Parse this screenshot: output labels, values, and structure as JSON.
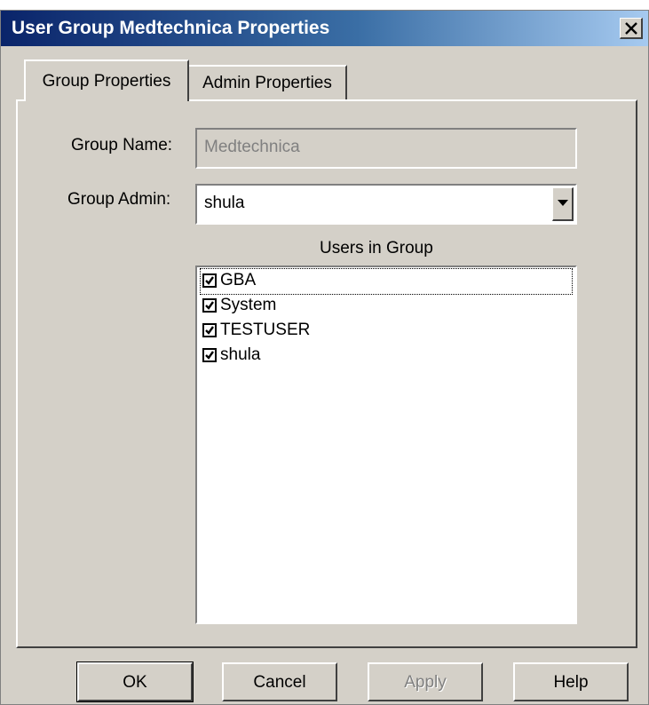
{
  "window": {
    "title": "User Group Medtechnica Properties",
    "close_icon": "close-icon"
  },
  "tabs": [
    {
      "label": "Group Properties",
      "active": true
    },
    {
      "label": "Admin Properties",
      "active": false
    }
  ],
  "form": {
    "group_name_label": "Group Name:",
    "group_name_value": "Medtechnica",
    "group_admin_label": "Group Admin:",
    "group_admin_value": "shula",
    "users_label": "Users in Group"
  },
  "users": [
    {
      "name": "GBA",
      "checked": true
    },
    {
      "name": "System",
      "checked": true
    },
    {
      "name": "TESTUSER",
      "checked": true
    },
    {
      "name": "shula",
      "checked": true
    }
  ],
  "buttons": {
    "ok": "OK",
    "cancel": "Cancel",
    "apply": "Apply",
    "help": "Help"
  },
  "colors": {
    "title_gradient_start": "#0a246a",
    "title_gradient_end": "#a6caf0",
    "dialog_face": "#d4d0c8",
    "disabled_text": "#808080"
  }
}
